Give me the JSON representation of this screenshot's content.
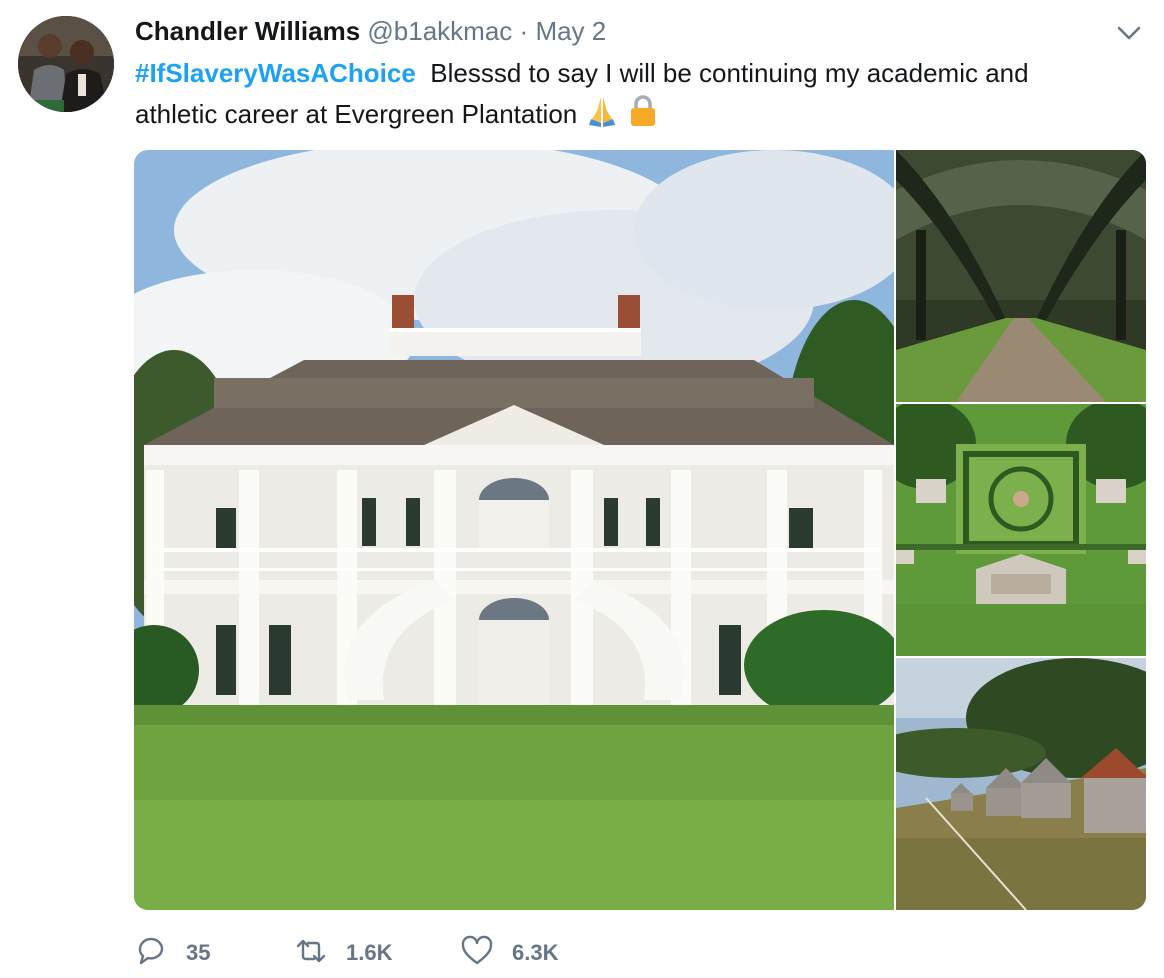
{
  "tweet": {
    "author_name": "Chandler Williams",
    "handle": "@b1akkmac",
    "separator": "·",
    "date": "May 2",
    "hashtag": "#IfSlaveryWasAChoice",
    "text_line1": "Blesssd to say I will be continuing my academic and",
    "text_line2": "athletic career at Evergreen Plantation"
  },
  "icons": {
    "avatar": "avatar-photo",
    "menu": "chevron-down-icon",
    "emoji_1": "praying-hands-emoji",
    "emoji_2": "lock-emoji",
    "reply": "reply-icon",
    "retweet": "retweet-icon",
    "like": "heart-icon"
  },
  "media": [
    {
      "id": "main",
      "subject": "plantation-house"
    },
    {
      "id": "top-right",
      "subject": "oak-alley-road"
    },
    {
      "id": "mid-right",
      "subject": "aerial-garden"
    },
    {
      "id": "bottom-right",
      "subject": "slave-cabins"
    }
  ],
  "actions": {
    "reply_count": "35",
    "retweet_count": "1.6K",
    "like_count": "6.3K"
  },
  "colors": {
    "hashtag": "#1da1f2",
    "secondary_text": "#657786",
    "primary_text": "#14171a"
  }
}
